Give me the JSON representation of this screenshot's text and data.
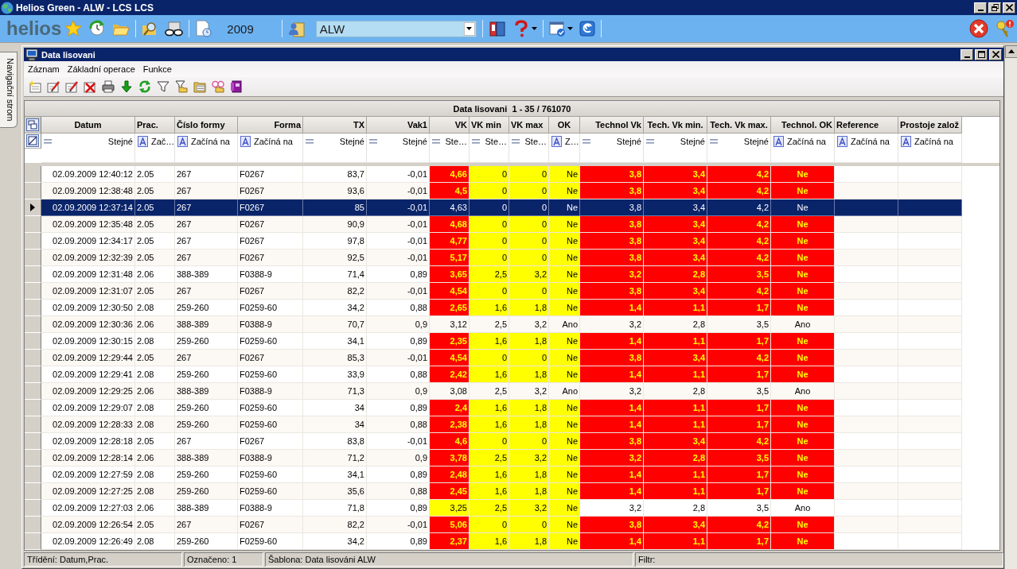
{
  "window": {
    "title": "Helios Green - ALW - LCS LCS"
  },
  "main_toolbar": {
    "logo": "helios",
    "year": "2009",
    "organization": {
      "value": "ALW"
    }
  },
  "navigation_tab": {
    "label": "Navigační strom"
  },
  "document_window": {
    "title": "Data lisovani",
    "menu": [
      "Záznam",
      "Základní operace",
      "Funkce"
    ]
  },
  "grid": {
    "caption": "Data lisovani  1 - 35 / 761070",
    "columns": [
      {
        "label": "Datum",
        "filter": {
          "kind": "equals",
          "label": "Stejné"
        }
      },
      {
        "label": "Prac.",
        "filter": {
          "kind": "text",
          "label": "Zač…"
        }
      },
      {
        "label": "Číslo formy",
        "filter": {
          "kind": "text",
          "label": "Začíná na"
        }
      },
      {
        "label": "Forma",
        "filter": {
          "kind": "text",
          "label": "Začíná na"
        }
      },
      {
        "label": "TX",
        "filter": {
          "kind": "equals",
          "label": "Stejné"
        }
      },
      {
        "label": "Vak1",
        "filter": {
          "kind": "equals",
          "label": "Stejné"
        }
      },
      {
        "label": "VK",
        "filter": {
          "kind": "equals",
          "label": "Ste…"
        }
      },
      {
        "label": "VK min",
        "filter": {
          "kind": "equals",
          "label": "Ste…"
        }
      },
      {
        "label": "VK max",
        "filter": {
          "kind": "equals",
          "label": "Ste…"
        }
      },
      {
        "label": "OK",
        "filter": {
          "kind": "text",
          "label": "Z…"
        }
      },
      {
        "label": "Technol Vk",
        "filter": {
          "kind": "equals",
          "label": "Stejné"
        }
      },
      {
        "label": "Tech. Vk min.",
        "filter": {
          "kind": "equals",
          "label": "Stejné"
        }
      },
      {
        "label": "Tech. Vk max.",
        "filter": {
          "kind": "equals",
          "label": "Stejné"
        }
      },
      {
        "label": "Technol. OK",
        "filter": {
          "kind": "text",
          "label": "Začíná na"
        }
      },
      {
        "label": "Reference",
        "filter": {
          "kind": "text",
          "label": "Začíná na"
        }
      },
      {
        "label": "Prostoje založ",
        "filter": {
          "kind": "text",
          "label": "Začíná na"
        }
      }
    ],
    "rows": [
      {
        "selected": false,
        "vk_error": true,
        "vk_warning": false,
        "ok_warning": true,
        "technol_error": true,
        "cells": [
          "02.09.2009 12:40:12",
          "2.05",
          "267",
          "F0267",
          "83,7",
          "-0,01",
          "4,66",
          "0",
          "0",
          "Ne",
          "3,8",
          "3,4",
          "4,2",
          "Ne"
        ]
      },
      {
        "selected": false,
        "vk_error": true,
        "vk_warning": false,
        "ok_warning": true,
        "technol_error": true,
        "cells": [
          "02.09.2009 12:38:48",
          "2.05",
          "267",
          "F0267",
          "93,6",
          "-0,01",
          "4,5",
          "0",
          "0",
          "Ne",
          "3,8",
          "3,4",
          "4,2",
          "Ne"
        ]
      },
      {
        "selected": true,
        "cells": [
          "02.09.2009 12:37:14",
          "2.05",
          "267",
          "F0267",
          "85",
          "-0,01",
          "4,63",
          "0",
          "0",
          "Ne",
          "3,8",
          "3,4",
          "4,2",
          "Ne"
        ]
      },
      {
        "selected": false,
        "vk_error": true,
        "vk_warning": false,
        "ok_warning": true,
        "technol_error": true,
        "cells": [
          "02.09.2009 12:35:48",
          "2.05",
          "267",
          "F0267",
          "90,9",
          "-0,01",
          "4,68",
          "0",
          "0",
          "Ne",
          "3,8",
          "3,4",
          "4,2",
          "Ne"
        ]
      },
      {
        "selected": false,
        "vk_error": true,
        "vk_warning": false,
        "ok_warning": true,
        "technol_error": true,
        "cells": [
          "02.09.2009 12:34:17",
          "2.05",
          "267",
          "F0267",
          "97,8",
          "-0,01",
          "4,77",
          "0",
          "0",
          "Ne",
          "3,8",
          "3,4",
          "4,2",
          "Ne"
        ]
      },
      {
        "selected": false,
        "vk_error": true,
        "vk_warning": false,
        "ok_warning": true,
        "technol_error": true,
        "cells": [
          "02.09.2009 12:32:39",
          "2.05",
          "267",
          "F0267",
          "92,5",
          "-0,01",
          "5,17",
          "0",
          "0",
          "Ne",
          "3,8",
          "3,4",
          "4,2",
          "Ne"
        ]
      },
      {
        "selected": false,
        "vk_error": true,
        "vk_warning": false,
        "ok_warning": true,
        "technol_error": true,
        "cells": [
          "02.09.2009 12:31:48",
          "2.06",
          "388-389",
          "F0388-9",
          "71,4",
          "0,89",
          "3,65",
          "2,5",
          "3,2",
          "Ne",
          "3,2",
          "2,8",
          "3,5",
          "Ne"
        ]
      },
      {
        "selected": false,
        "vk_error": true,
        "vk_warning": false,
        "ok_warning": true,
        "technol_error": true,
        "cells": [
          "02.09.2009 12:31:07",
          "2.05",
          "267",
          "F0267",
          "82,2",
          "-0,01",
          "4,54",
          "0",
          "0",
          "Ne",
          "3,8",
          "3,4",
          "4,2",
          "Ne"
        ]
      },
      {
        "selected": false,
        "vk_error": true,
        "vk_warning": false,
        "ok_warning": true,
        "technol_error": true,
        "cells": [
          "02.09.2009 12:30:50",
          "2.08",
          "259-260",
          "F0259-60",
          "34,2",
          "0,88",
          "2,65",
          "1,6",
          "1,8",
          "Ne",
          "1,4",
          "1,1",
          "1,7",
          "Ne"
        ]
      },
      {
        "selected": false,
        "vk_error": false,
        "vk_warning": false,
        "ok_warning": false,
        "technol_error": false,
        "cells": [
          "02.09.2009 12:30:36",
          "2.06",
          "388-389",
          "F0388-9",
          "70,7",
          "0,9",
          "3,12",
          "2,5",
          "3,2",
          "Ano",
          "3,2",
          "2,8",
          "3,5",
          "Ano"
        ]
      },
      {
        "selected": false,
        "vk_error": true,
        "vk_warning": false,
        "ok_warning": true,
        "technol_error": true,
        "cells": [
          "02.09.2009 12:30:15",
          "2.08",
          "259-260",
          "F0259-60",
          "34,1",
          "0,89",
          "2,35",
          "1,6",
          "1,8",
          "Ne",
          "1,4",
          "1,1",
          "1,7",
          "Ne"
        ]
      },
      {
        "selected": false,
        "vk_error": true,
        "vk_warning": false,
        "ok_warning": true,
        "technol_error": true,
        "cells": [
          "02.09.2009 12:29:44",
          "2.05",
          "267",
          "F0267",
          "85,3",
          "-0,01",
          "4,54",
          "0",
          "0",
          "Ne",
          "3,8",
          "3,4",
          "4,2",
          "Ne"
        ]
      },
      {
        "selected": false,
        "vk_error": true,
        "vk_warning": false,
        "ok_warning": true,
        "technol_error": true,
        "cells": [
          "02.09.2009 12:29:41",
          "2.08",
          "259-260",
          "F0259-60",
          "33,9",
          "0,88",
          "2,42",
          "1,6",
          "1,8",
          "Ne",
          "1,4",
          "1,1",
          "1,7",
          "Ne"
        ]
      },
      {
        "selected": false,
        "vk_error": false,
        "vk_warning": false,
        "ok_warning": false,
        "technol_error": false,
        "cells": [
          "02.09.2009 12:29:25",
          "2.06",
          "388-389",
          "F0388-9",
          "71,3",
          "0,9",
          "3,08",
          "2,5",
          "3,2",
          "Ano",
          "3,2",
          "2,8",
          "3,5",
          "Ano"
        ]
      },
      {
        "selected": false,
        "vk_error": true,
        "vk_warning": false,
        "ok_warning": true,
        "technol_error": true,
        "cells": [
          "02.09.2009 12:29:07",
          "2.08",
          "259-260",
          "F0259-60",
          "34",
          "0,89",
          "2,4",
          "1,6",
          "1,8",
          "Ne",
          "1,4",
          "1,1",
          "1,7",
          "Ne"
        ]
      },
      {
        "selected": false,
        "vk_error": true,
        "vk_warning": false,
        "ok_warning": true,
        "technol_error": true,
        "cells": [
          "02.09.2009 12:28:33",
          "2.08",
          "259-260",
          "F0259-60",
          "34",
          "0,88",
          "2,38",
          "1,6",
          "1,8",
          "Ne",
          "1,4",
          "1,1",
          "1,7",
          "Ne"
        ]
      },
      {
        "selected": false,
        "vk_error": true,
        "vk_warning": false,
        "ok_warning": true,
        "technol_error": true,
        "cells": [
          "02.09.2009 12:28:18",
          "2.05",
          "267",
          "F0267",
          "83,8",
          "-0,01",
          "4,6",
          "0",
          "0",
          "Ne",
          "3,8",
          "3,4",
          "4,2",
          "Ne"
        ]
      },
      {
        "selected": false,
        "vk_error": true,
        "vk_warning": false,
        "ok_warning": true,
        "technol_error": true,
        "cells": [
          "02.09.2009 12:28:14",
          "2.06",
          "388-389",
          "F0388-9",
          "71,2",
          "0,9",
          "3,78",
          "2,5",
          "3,2",
          "Ne",
          "3,2",
          "2,8",
          "3,5",
          "Ne"
        ]
      },
      {
        "selected": false,
        "vk_error": true,
        "vk_warning": false,
        "ok_warning": true,
        "technol_error": true,
        "cells": [
          "02.09.2009 12:27:59",
          "2.08",
          "259-260",
          "F0259-60",
          "34,1",
          "0,89",
          "2,48",
          "1,6",
          "1,8",
          "Ne",
          "1,4",
          "1,1",
          "1,7",
          "Ne"
        ]
      },
      {
        "selected": false,
        "vk_error": true,
        "vk_warning": false,
        "ok_warning": true,
        "technol_error": true,
        "cells": [
          "02.09.2009 12:27:25",
          "2.08",
          "259-260",
          "F0259-60",
          "35,6",
          "0,88",
          "2,45",
          "1,6",
          "1,8",
          "Ne",
          "1,4",
          "1,1",
          "1,7",
          "Ne"
        ]
      },
      {
        "selected": false,
        "vk_error": false,
        "vk_warning": true,
        "ok_warning": true,
        "technol_error": false,
        "cells": [
          "02.09.2009 12:27:03",
          "2.06",
          "388-389",
          "F0388-9",
          "71,8",
          "0,89",
          "3,25",
          "2,5",
          "3,2",
          "Ne",
          "3,2",
          "2,8",
          "3,5",
          "Ano"
        ]
      },
      {
        "selected": false,
        "vk_error": true,
        "vk_warning": false,
        "ok_warning": true,
        "technol_error": true,
        "cells": [
          "02.09.2009 12:26:54",
          "2.05",
          "267",
          "F0267",
          "82,2",
          "-0,01",
          "5,06",
          "0",
          "0",
          "Ne",
          "3,8",
          "3,4",
          "4,2",
          "Ne"
        ]
      },
      {
        "selected": false,
        "vk_error": true,
        "vk_warning": false,
        "ok_warning": true,
        "technol_error": true,
        "cells": [
          "02.09.2009 12:26:49",
          "2.08",
          "259-260",
          "F0259-60",
          "34,2",
          "0,89",
          "2,37",
          "1,6",
          "1,8",
          "Ne",
          "1,4",
          "1,1",
          "1,7",
          "Ne"
        ]
      }
    ]
  },
  "status_bar": [
    "Třídění: Datum,Prac.",
    "Označeno: 1",
    "Šablona: Data lisováni ALW",
    "Filtr:"
  ]
}
